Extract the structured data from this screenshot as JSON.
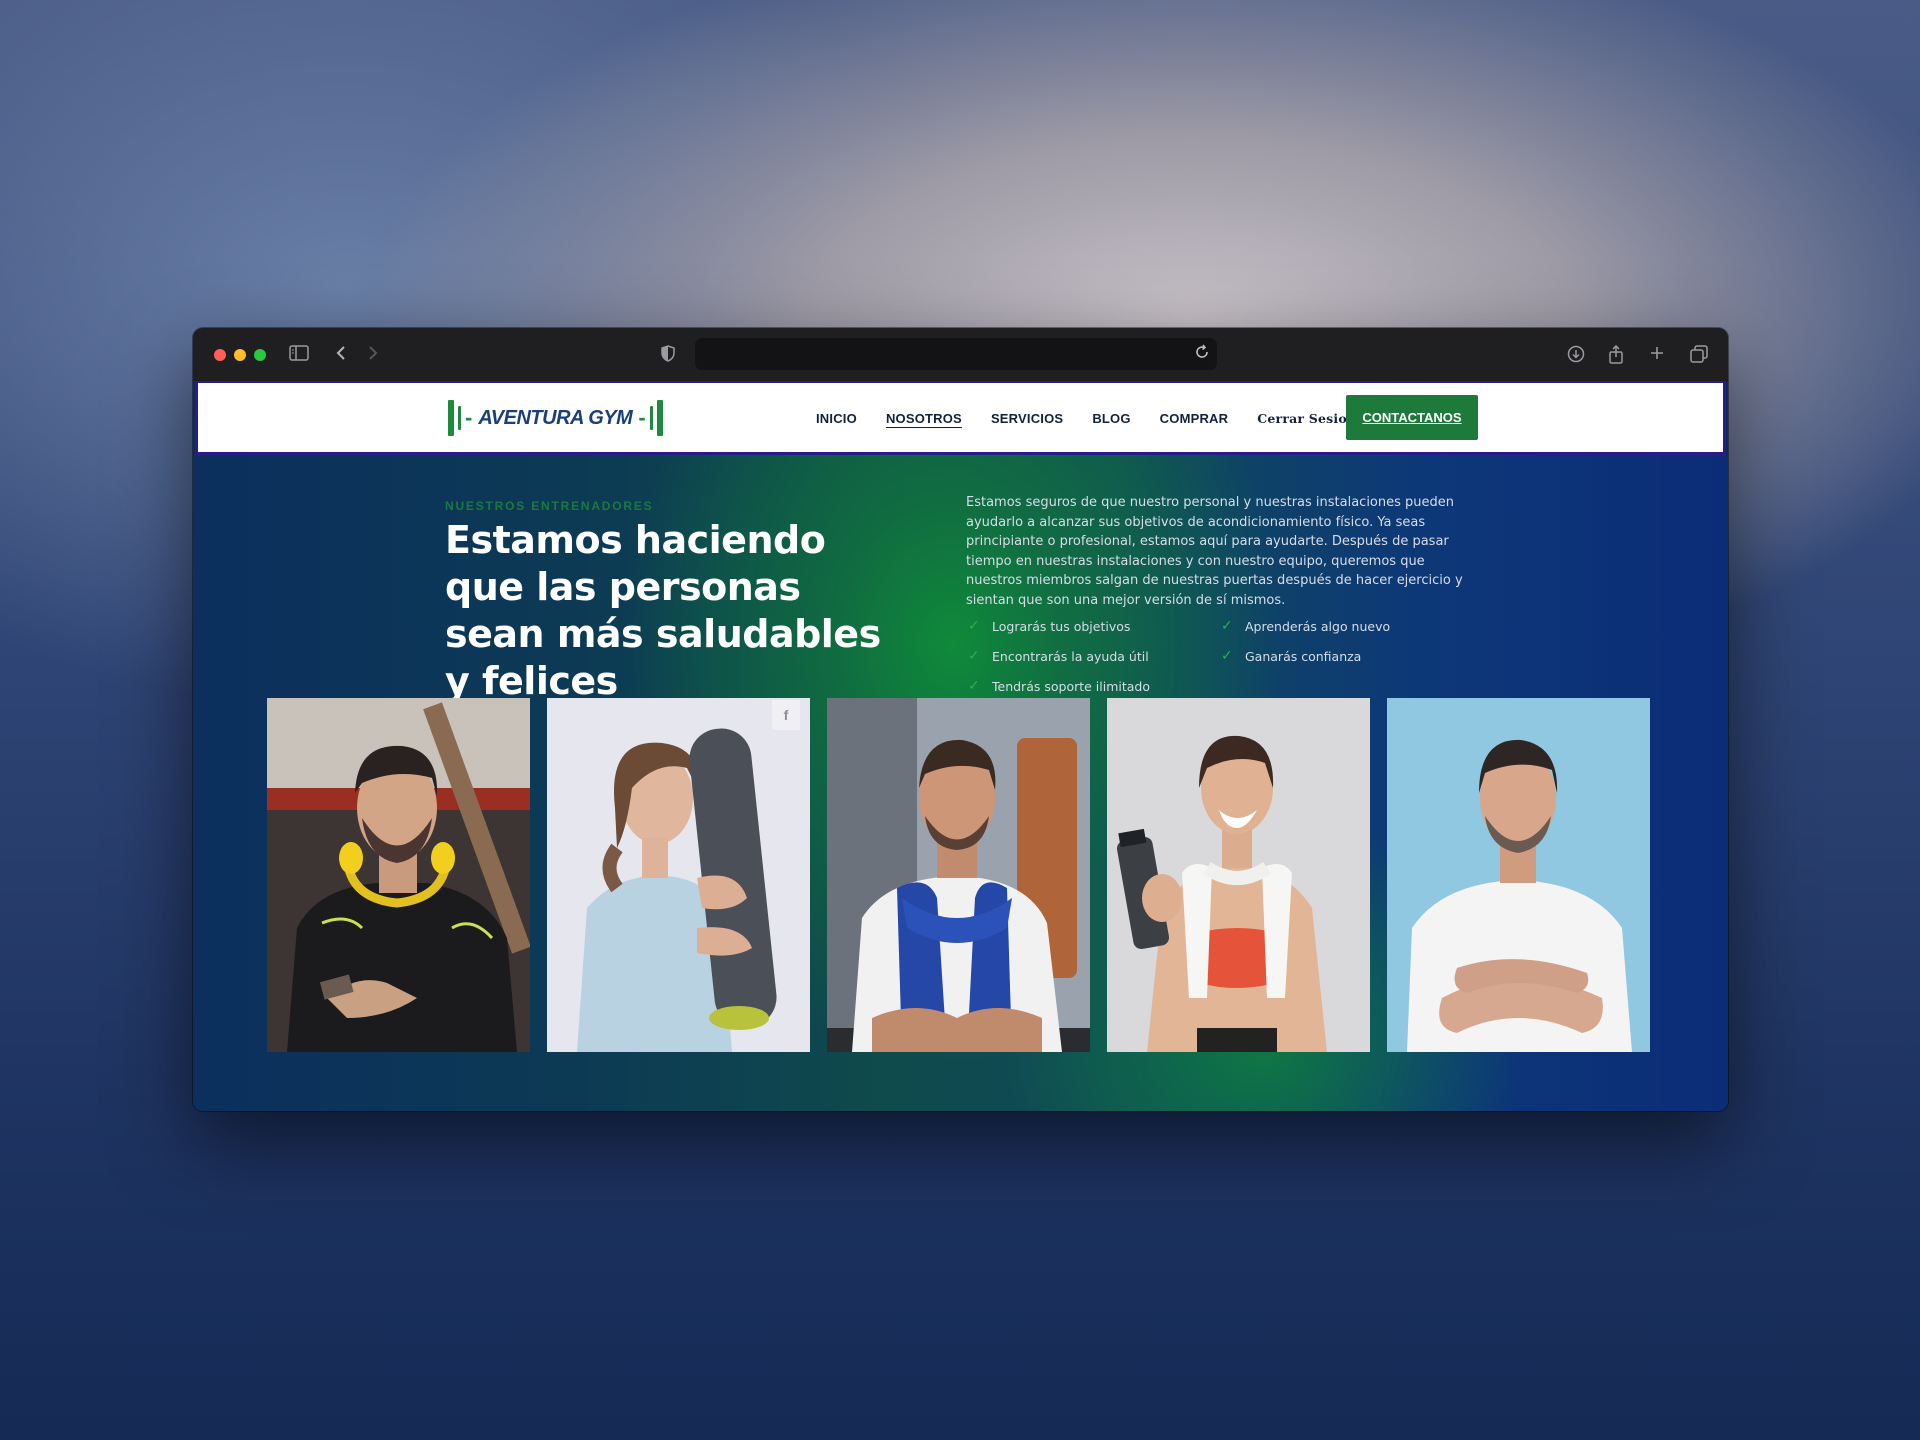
{
  "browser": {
    "address_text": ""
  },
  "header": {
    "logo_text": "AVENTURA GYM",
    "nav": [
      {
        "label": "INICIO"
      },
      {
        "label": "NOSOTROS"
      },
      {
        "label": "SERVICIOS"
      },
      {
        "label": "BLOG"
      },
      {
        "label": "COMPRAR"
      },
      {
        "label": "Cerrar Sesion"
      }
    ],
    "cta_label": "CONTACTANOS"
  },
  "hero": {
    "kicker": "NUESTROS ENTRENADORES",
    "headline": "Estamos haciendo que las personas sean más saludables y felices",
    "description": "Estamos seguros de que nuestro personal y nuestras instalaciones pueden ayudarlo a alcanzar sus objetivos de acondicionamiento físico. Ya seas principiante o profesional, estamos aquí para ayudarte. Después de pasar tiempo en nuestras instalaciones y con nuestro equipo, queremos que nuestros miembros salgan de nuestras puertas después de hacer ejercicio y sientan que son una mejor versión de sí mismos.",
    "benefits": [
      "Lograrás tus objetivos",
      "Aprenderás algo nuevo",
      "Encontrarás la ayuda útil",
      "Ganarás confianza",
      "Tendrás soporte ilimitado"
    ]
  },
  "trainers": {
    "facebook_icon_glyph": "f"
  },
  "colors": {
    "brand_green": "#1d7a3a",
    "nav_text": "#14213d",
    "header_border": "#2a1a8c"
  },
  "icons": {
    "sidebar": "sidebar-icon",
    "back": "chevron-left-icon",
    "forward": "chevron-right-icon",
    "shield": "shield-icon",
    "reload": "reload-icon",
    "download": "download-icon",
    "share": "share-icon",
    "new_tab": "plus-icon",
    "tabs": "tabs-icon",
    "chat": "chat-icon"
  }
}
